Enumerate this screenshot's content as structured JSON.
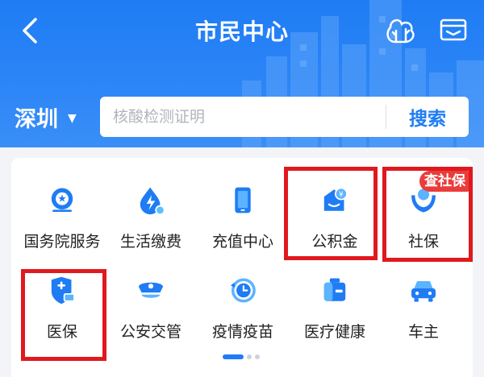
{
  "header": {
    "title": "市民中心",
    "back_icon": "chevron-left-icon",
    "tree_icon": "tree-icon",
    "wallet_icon": "wallet-icon"
  },
  "search": {
    "city": "深圳",
    "city_caret": "▼",
    "placeholder": "核酸检测证明",
    "button_label": "搜索"
  },
  "services": {
    "row1": [
      {
        "label": "国务院服务",
        "icon": "state-council-emblem-icon"
      },
      {
        "label": "生活缴费",
        "icon": "utility-payment-icon"
      },
      {
        "label": "充值中心",
        "icon": "phone-recharge-icon"
      },
      {
        "label": "公积金",
        "icon": "housing-fund-icon"
      },
      {
        "label": "社保",
        "icon": "social-security-icon",
        "badge": "查社保"
      }
    ],
    "row2": [
      {
        "label": "医保",
        "icon": "medical-insurance-icon"
      },
      {
        "label": "公安交管",
        "icon": "police-cap-icon"
      },
      {
        "label": "疫情疫苗",
        "icon": "vaccine-clock-icon"
      },
      {
        "label": "医疗健康",
        "icon": "healthcare-icon"
      },
      {
        "label": "车主",
        "icon": "car-icon"
      }
    ]
  },
  "pagination": {
    "pages": 3,
    "current": 1
  },
  "colors": {
    "brand_blue": "#1f7cf4",
    "highlight_red": "#e0191e",
    "badge_red": "#ea3d3b"
  }
}
